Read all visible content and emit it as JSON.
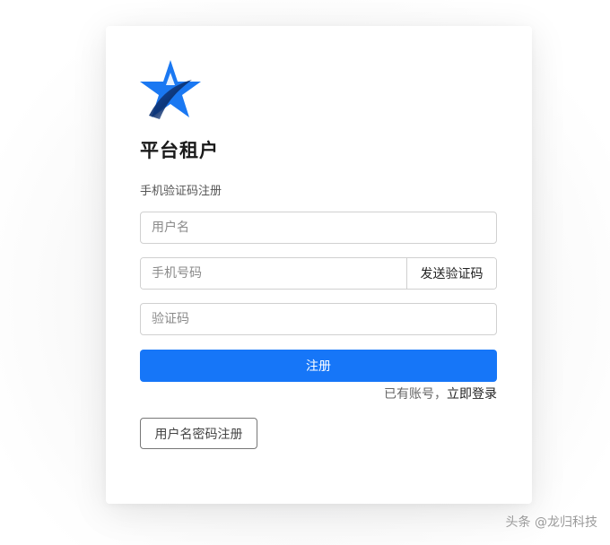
{
  "brand": {
    "logo_icon": "star-logo-icon",
    "title": "平台租户"
  },
  "form": {
    "subtitle": "手机验证码注册",
    "username_placeholder": "用户名",
    "phone_placeholder": "手机号码",
    "send_code_label": "发送验证码",
    "code_placeholder": "验证码",
    "register_label": "注册"
  },
  "login_prompt": {
    "text": "已有账号，",
    "link": "立即登录"
  },
  "alt_register_label": "用户名密码注册",
  "watermark": "头条 @龙归科技",
  "colors": {
    "primary": "#1676f8"
  }
}
